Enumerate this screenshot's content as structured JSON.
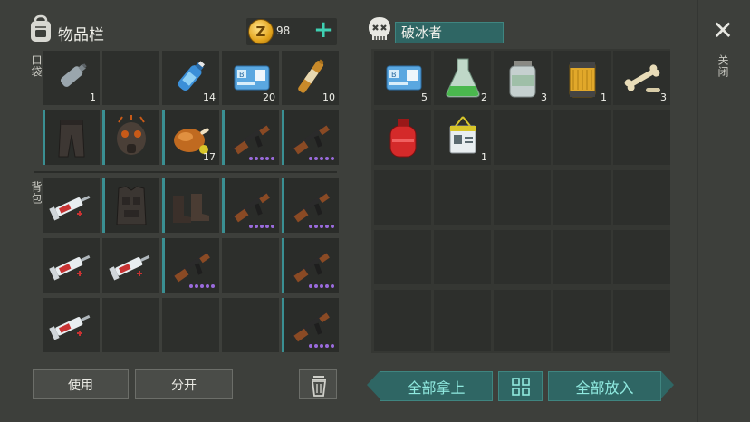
{
  "inventory": {
    "title": "物品栏",
    "coins": "98",
    "plus_label": "+",
    "pocket_label": "口袋",
    "backpack_label": "背包",
    "pocket_row": [
      {
        "item": "plastic-bottle",
        "count": "1"
      },
      {
        "item": "empty",
        "count": ""
      },
      {
        "item": "water-bottle",
        "count": "14"
      },
      {
        "item": "sector-b-keycard",
        "count": "20"
      },
      {
        "item": "ampoule",
        "count": "10"
      }
    ],
    "equip_row": [
      {
        "item": "pants",
        "count": ""
      },
      {
        "item": "gas-mask",
        "count": ""
      },
      {
        "item": "roast-chicken",
        "count": "17"
      },
      {
        "item": "ak-rifle",
        "count": ""
      },
      {
        "item": "ak-rifle",
        "count": ""
      }
    ],
    "backpack_rows": [
      [
        {
          "item": "syringe",
          "count": ""
        },
        {
          "item": "body-armor",
          "count": ""
        },
        {
          "item": "boots",
          "count": ""
        },
        {
          "item": "ak-rifle",
          "count": ""
        },
        {
          "item": "ak-rifle",
          "count": ""
        }
      ],
      [
        {
          "item": "syringe",
          "count": ""
        },
        {
          "item": "syringe",
          "count": ""
        },
        {
          "item": "ak-rifle",
          "count": ""
        },
        {
          "item": "empty",
          "count": ""
        },
        {
          "item": "ak-rifle",
          "count": ""
        }
      ],
      [
        {
          "item": "syringe",
          "count": ""
        },
        {
          "item": "empty",
          "count": ""
        },
        {
          "item": "empty",
          "count": ""
        },
        {
          "item": "empty",
          "count": ""
        },
        {
          "item": "ak-rifle",
          "count": ""
        }
      ]
    ],
    "use_button": "使用",
    "split_button": "分开"
  },
  "loot": {
    "name": "破冰者",
    "items": [
      {
        "item": "sector-b-keycard",
        "count": "5"
      },
      {
        "item": "flask",
        "count": "2"
      },
      {
        "item": "jar",
        "count": "3"
      },
      {
        "item": "filter",
        "count": "1"
      },
      {
        "item": "bones",
        "count": "3"
      },
      {
        "item": "gas-canister",
        "count": ""
      },
      {
        "item": "id-badge",
        "count": "1"
      }
    ],
    "take_all_button": "全部拿上",
    "put_all_button": "全部放入",
    "sort_icon": "grid-icon"
  },
  "close_label": "关闭",
  "colors": {
    "accent": "#3fd0b2",
    "teal_button": "#2f6664",
    "rarity_dot": "#9a6bdc"
  }
}
